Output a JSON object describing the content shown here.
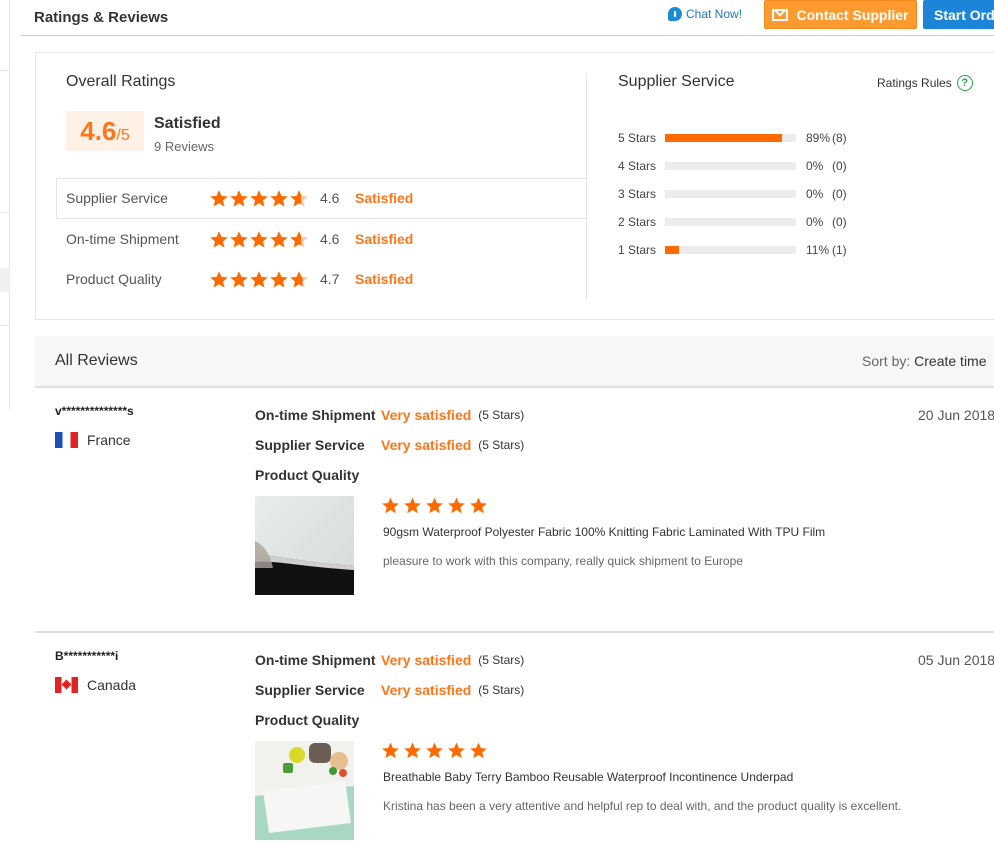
{
  "header": {
    "title": "Ratings & Reviews",
    "chat_label": "Chat Now!",
    "contact_label": "Contact Supplier",
    "start_label": "Start Order"
  },
  "colors": {
    "accent": "#ff7519",
    "primary": "#1d85d8",
    "contact": "#ff9a2e",
    "star": "#ff6a00"
  },
  "overall": {
    "title": "Overall Ratings",
    "score": "4.6",
    "score_denominator": "/5",
    "label": "Satisfied",
    "count": "9 Reviews",
    "rows": [
      {
        "label": "Supplier Service",
        "value": "4.6",
        "stars": 4.6,
        "status": "Satisfied"
      },
      {
        "label": "On-time Shipment",
        "value": "4.6",
        "stars": 4.6,
        "status": "Satisfied"
      },
      {
        "label": "Product Quality",
        "value": "4.7",
        "stars": 4.7,
        "status": "Satisfied"
      }
    ]
  },
  "supplier_service": {
    "title": "Supplier Service",
    "rules_label": "Ratings Rules",
    "rules_icon": "?",
    "distribution": [
      {
        "label": "5 Stars",
        "fraction": 0.89,
        "percent": "89%",
        "count": "(8)"
      },
      {
        "label": "4 Stars",
        "fraction": 0,
        "percent": "0%",
        "count": "(0)"
      },
      {
        "label": "3 Stars",
        "fraction": 0,
        "percent": "0%",
        "count": "(0)"
      },
      {
        "label": "2 Stars",
        "fraction": 0,
        "percent": "0%",
        "count": "(0)"
      },
      {
        "label": "1 Stars",
        "fraction": 0.11,
        "percent": "11%",
        "count": "(1)"
      }
    ]
  },
  "all_reviews": {
    "title": "All Reviews",
    "sort_label": "Sort by:",
    "sort_value": "Create time"
  },
  "reviews": [
    {
      "user": "v**************s",
      "country": "France",
      "flag_icon": "flag-france-icon",
      "date": "20 Jun 2018",
      "lines": [
        {
          "key": "On-time Shipment",
          "value": "Very satisfied",
          "stars": "(5 Stars)"
        },
        {
          "key": "Supplier Service",
          "value": "Very satisfied",
          "stars": "(5 Stars)"
        },
        {
          "key": "Product Quality",
          "value": "",
          "stars": ""
        }
      ],
      "product_stars": 5,
      "product": "90gsm Waterproof Polyester Fabric 100% Knitting Fabric Laminated With TPU Film",
      "comment": "pleasure to work with this company, really quick shipment to Europe"
    },
    {
      "user": "B***********i",
      "country": "Canada",
      "flag_icon": "flag-canada-icon",
      "date": "05 Jun 2018",
      "lines": [
        {
          "key": "On-time Shipment",
          "value": "Very satisfied",
          "stars": "(5 Stars)"
        },
        {
          "key": "Supplier Service",
          "value": "Very satisfied",
          "stars": "(5 Stars)"
        },
        {
          "key": "Product Quality",
          "value": "",
          "stars": ""
        }
      ],
      "product_stars": 5,
      "product": "Breathable Baby Terry Bamboo Reusable Waterproof Incontinence Underpad",
      "comment": "Kristina has been a very attentive and helpful rep to deal with, and the product quality is excellent."
    }
  ]
}
